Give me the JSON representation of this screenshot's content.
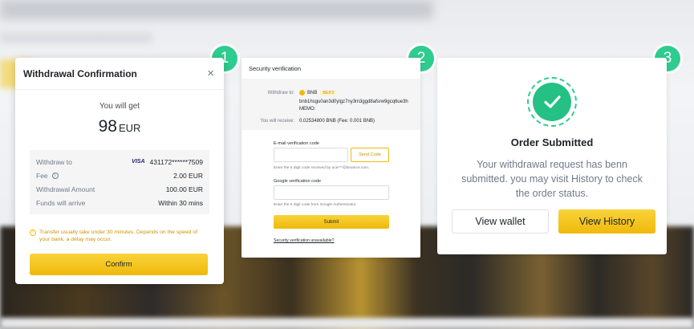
{
  "steps": [
    "1",
    "2",
    "3"
  ],
  "withdrawal": {
    "title": "Withdrawal Confirmation",
    "close": "×",
    "you_will_get_label": "You will get",
    "amount": "98",
    "currency": "EUR",
    "details": [
      {
        "key": "Withdraw to",
        "value": "431172******7509",
        "card_brand": "VISA"
      },
      {
        "key": "Fee",
        "value": "2.00 EUR"
      },
      {
        "key": "Withdrawal Amount",
        "value": "100.00 EUR"
      },
      {
        "key": "Funds will arrive",
        "value": "Within 30 mins"
      }
    ],
    "note": "Transfer usually take under 30 minutes. Depends on the speed of your bank, a delay may occur.",
    "confirm_label": "Confirm"
  },
  "security": {
    "title": "Security verification",
    "withdraw_to_label": "Withdraw to:",
    "coin": "BNB",
    "network": "BEP2",
    "address": "bnb1hsgu0an3d0ylgz7ny3m3ggd8afsrw9gcq6ue3h",
    "memo_label": "MEMO:",
    "receive_label": "You will receive:",
    "receive_value": "0.02534800 BNB (Fee: 0.001 BNB)",
    "email_label": "E-mail verification code",
    "send_code": "Send Code",
    "email_hint": "Enter the 6 digit code received by aca***@binance.com.",
    "google_label": "Google verification code",
    "google_hint": "Enter the 6 digit code from Google Authenticator.",
    "submit": "Submit",
    "unavailable_link": "Security verification unavailable?"
  },
  "order": {
    "title": "Order Submitted",
    "message": "Your withdrawal request has benn submitted. you  may visit History to check the order status.",
    "view_wallet": "View wallet",
    "view_history": "View History"
  },
  "colors": {
    "accent_green": "#2ecc8f",
    "brand_yellow": "#f0b90b",
    "text_dark": "#1e2329",
    "text_muted": "#707a8a"
  },
  "icons": {
    "close": "close-icon",
    "info": "info-icon",
    "warning": "warning-icon",
    "check": "check-icon",
    "coin": "bnb-coin-icon",
    "card": "visa-logo"
  }
}
